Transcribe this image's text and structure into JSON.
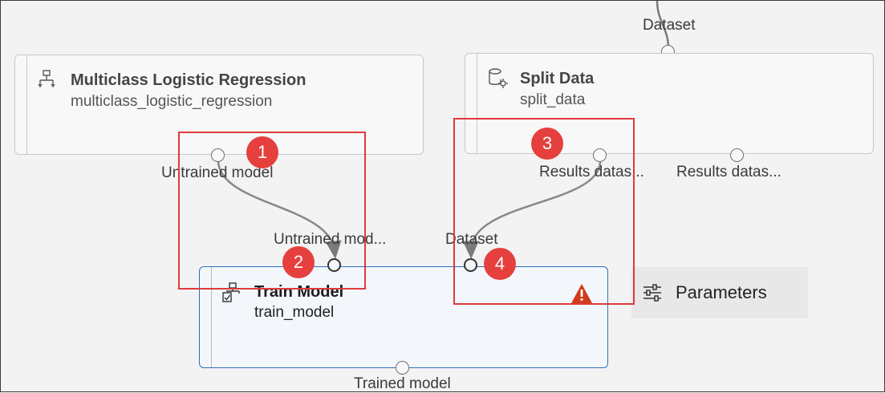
{
  "top_input": {
    "label": "Dataset"
  },
  "nodes": {
    "logistic": {
      "title": "Multiclass Logistic Regression",
      "subtitle": "multiclass_logistic_regression",
      "icon": "tree-icon",
      "output_label": "Untrained model"
    },
    "split": {
      "title": "Split Data",
      "subtitle": "split_data",
      "icon": "database-gear-icon",
      "output1_label": "Results datas...",
      "output2_label": "Results datas..."
    },
    "train": {
      "title": "Train Model",
      "subtitle": "train_model",
      "icon": "train-model-icon",
      "input1_label": "Untrained mod...",
      "input2_label": "Dataset",
      "output_label": "Trained model",
      "status": "warning"
    }
  },
  "callouts": [
    "1",
    "2",
    "3",
    "4"
  ],
  "parameters_button": {
    "label": "Parameters",
    "icon": "sliders-icon"
  },
  "colors": {
    "highlight": "#e03a3a",
    "badge": "#e5403d",
    "selected_border": "#2f6fbd",
    "warning": "#d13b1a"
  }
}
